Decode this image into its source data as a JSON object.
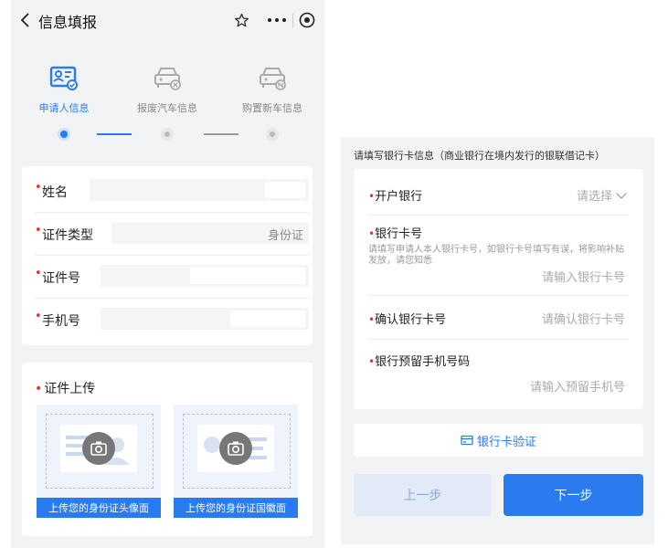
{
  "header": {
    "title": "信息填报"
  },
  "steps": [
    {
      "label": "申请人信息",
      "icon": "applicant-card-icon",
      "active": true
    },
    {
      "label": "报废汽车信息",
      "icon": "scrap-car-icon",
      "active": false
    },
    {
      "label": "购置新车信息",
      "icon": "new-car-icon",
      "active": false
    }
  ],
  "form": {
    "name_label": "姓名",
    "id_type_label": "证件类型",
    "id_type_value": "身份证",
    "id_number_label": "证件号",
    "phone_label": "手机号"
  },
  "upload": {
    "title": "证件上传",
    "front_caption": "上传您的身份证头像面",
    "back_caption": "上传您的身份证国徽面"
  },
  "bank": {
    "notice": "请填写银行卡信息（商业银行在境内发行的银联借记卡）",
    "bank_label": "开户银行",
    "bank_placeholder": "请选择",
    "card_label": "银行卡号",
    "card_hint": "请填写申请人本人银行卡号，如银行卡号填写有误，将影响补贴发放，请您知悉",
    "card_placeholder": "请输入银行卡号",
    "confirm_label": "确认银行卡号",
    "confirm_placeholder": "请确认银行卡号",
    "phone_label": "银行预留手机号码",
    "phone_placeholder": "请输入预留手机号",
    "verify_button": "银行卡验证",
    "prev_button": "上一步",
    "next_button": "下一步"
  },
  "colors": {
    "accent": "#2b7bf0",
    "required": "#e5322e"
  }
}
